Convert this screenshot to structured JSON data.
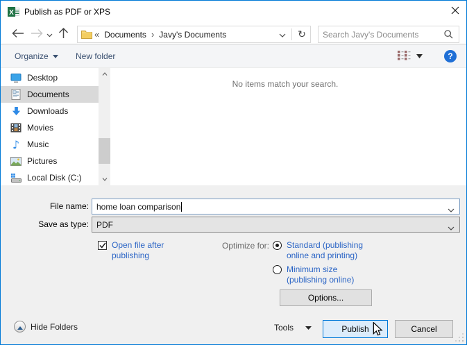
{
  "window": {
    "title": "Publish as PDF or XPS"
  },
  "nav": {
    "breadcrumb": {
      "overflow": "«",
      "separator": "›",
      "items": [
        "Documents",
        "Javy's Documents"
      ]
    },
    "refresh_glyph": "↻",
    "search": {
      "placeholder": "Search Javy's Documents"
    }
  },
  "toolbar": {
    "organize": "Organize",
    "new_folder": "New folder"
  },
  "sidebar": {
    "items": [
      {
        "label": "Desktop",
        "icon": "desktop-icon",
        "selected": false
      },
      {
        "label": "Documents",
        "icon": "document-icon",
        "selected": true
      },
      {
        "label": "Downloads",
        "icon": "download-arrow-icon",
        "selected": false
      },
      {
        "label": "Movies",
        "icon": "film-icon",
        "selected": false
      },
      {
        "label": "Music",
        "icon": "music-note-icon",
        "selected": false
      },
      {
        "label": "Pictures",
        "icon": "picture-icon",
        "selected": false
      },
      {
        "label": "Local Disk (C:)",
        "icon": "hard-drive-icon",
        "selected": false
      }
    ],
    "music_glyph": "♪"
  },
  "main": {
    "empty_message": "No items match your search."
  },
  "form": {
    "file_name_label": "File name:",
    "file_name_value": "home loan comparison",
    "save_as_type_label": "Save as type:",
    "save_as_type_value": "PDF",
    "open_file_checkbox": {
      "label": "Open file after publishing",
      "checked": true
    },
    "optimize_for_label": "Optimize for:",
    "optimize_options": [
      {
        "label": "Standard (publishing online and printing)",
        "selected": true
      },
      {
        "label": "Minimum size (publishing online)",
        "selected": false
      }
    ],
    "options_button": "Options..."
  },
  "footer": {
    "hide_folders": "Hide Folders",
    "tools": "Tools",
    "publish": "Publish",
    "cancel": "Cancel"
  },
  "colors": {
    "accent": "#0079d7",
    "selection_gray": "#d9d9d9",
    "link_blue": "#2a64c5",
    "toolbar_text": "#3b5171",
    "publish_fill": "#dcecfb"
  }
}
